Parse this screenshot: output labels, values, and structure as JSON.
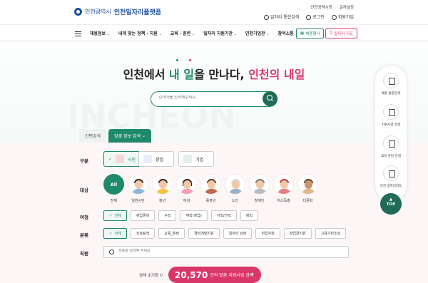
{
  "header": {
    "city_name": "인천광역시",
    "platform_name": "인천일자리플랫폼",
    "top_links": [
      "인천광역시청",
      "글자설정"
    ],
    "utility_links": [
      "일자리 통합검색",
      "로그인",
      "회원가입"
    ]
  },
  "nav": {
    "menu": [
      "채용정보",
      "내게 맞는 정책 · 지원",
      "교육 · 훈련",
      "일자리 지원기관",
      "인천기업관",
      "참여소통"
    ],
    "badge_green": "채용행사",
    "badge_red": "일자리 지도"
  },
  "hero": {
    "headline_prefix": "인천에서 ",
    "headline_my": "내",
    "headline_space": " ",
    "headline_job": "일",
    "headline_middle": "을 만나다, ",
    "headline_incheon": "인천의 ",
    "headline_tomorrow": "내일",
    "search_placeholder": "검색어를 입력해주세요.",
    "bg_text": "INCHEON"
  },
  "tabs": [
    "간편검색",
    "맞춤 정보 검색"
  ],
  "filters": {
    "category": {
      "label": "구분",
      "options": [
        "시민",
        "창업",
        "기업"
      ],
      "selected": "시민"
    },
    "target": {
      "label": "대상",
      "options": [
        "All",
        "전체",
        "일반시민",
        "청년",
        "여성",
        "중장년",
        "노인",
        "장애인",
        "저소득층",
        "다문화"
      ]
    },
    "situation": {
      "label": "여정",
      "options": [
        "전체",
        "취업준비",
        "구직",
        "재직(창업)",
        "이직/전직",
        "퇴직"
      ]
    },
    "field": {
      "label": "분류",
      "options": [
        "전체",
        "진로탐색",
        "교육_훈련",
        "경력개발지원",
        "일자리 상담",
        "취업지원",
        "창업금지원",
        "고용기반조성"
      ]
    },
    "job": {
      "label": "직종",
      "placeholder": "직종을 검색해 주세요"
    }
  },
  "results": {
    "reset_label": "검색 초기화",
    "count": "20,570",
    "count_suffix": "건의 맞춤 지원사업 검색"
  },
  "side_menu": [
    "채용 통합검색",
    "지원사업 검색",
    "교육 훈련 검색",
    "인천 일자리지도"
  ],
  "top_label": "TOP",
  "colors": {
    "green": "#1f8a6b",
    "pink": "#d9376b",
    "navy": "#1d4f9c"
  }
}
